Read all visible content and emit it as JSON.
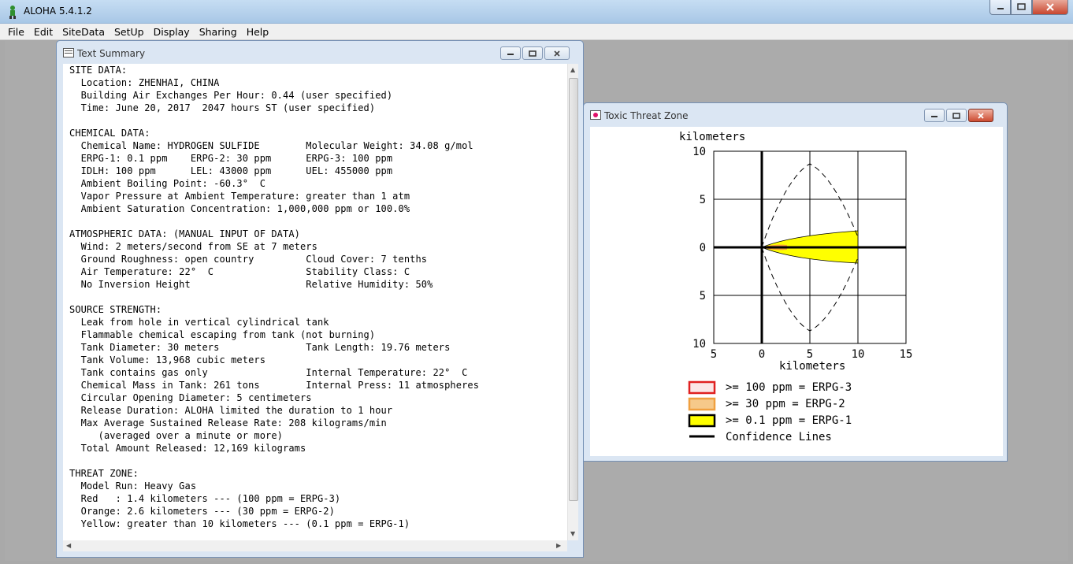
{
  "app": {
    "title": "ALOHA 5.4.1.2",
    "menu": [
      "File",
      "Edit",
      "SiteData",
      "SetUp",
      "Display",
      "Sharing",
      "Help"
    ]
  },
  "text_summary": {
    "title": "Text Summary",
    "lines": [
      "SITE DATA:",
      "  Location: ZHENHAI, CHINA",
      "  Building Air Exchanges Per Hour: 0.44 (user specified)",
      "  Time: June 20, 2017  2047 hours ST (user specified)",
      "",
      "CHEMICAL DATA:",
      "  Chemical Name: HYDROGEN SULFIDE        Molecular Weight: 34.08 g/mol",
      "  ERPG-1: 0.1 ppm    ERPG-2: 30 ppm      ERPG-3: 100 ppm",
      "  IDLH: 100 ppm      LEL: 43000 ppm      UEL: 455000 ppm",
      "  Ambient Boiling Point: -60.3°  C",
      "  Vapor Pressure at Ambient Temperature: greater than 1 atm",
      "  Ambient Saturation Concentration: 1,000,000 ppm or 100.0%",
      "",
      "ATMOSPHERIC DATA: (MANUAL INPUT OF DATA)",
      "  Wind: 2 meters/second from SE at 7 meters",
      "  Ground Roughness: open country         Cloud Cover: 7 tenths",
      "  Air Temperature: 22°  C                Stability Class: C",
      "  No Inversion Height                    Relative Humidity: 50%",
      "",
      "SOURCE STRENGTH:",
      "  Leak from hole in vertical cylindrical tank",
      "  Flammable chemical escaping from tank (not burning)",
      "  Tank Diameter: 30 meters               Tank Length: 19.76 meters",
      "  Tank Volume: 13,968 cubic meters",
      "  Tank contains gas only                 Internal Temperature: 22°  C",
      "  Chemical Mass in Tank: 261 tons        Internal Press: 11 atmospheres",
      "  Circular Opening Diameter: 5 centimeters",
      "  Release Duration: ALOHA limited the duration to 1 hour",
      "  Max Average Sustained Release Rate: 208 kilograms/min",
      "     (averaged over a minute or more)",
      "  Total Amount Released: 12,169 kilograms",
      "",
      "THREAT ZONE:",
      "  Model Run: Heavy Gas",
      "  Red   : 1.4 kilometers --- (100 ppm = ERPG-3)",
      "  Orange: 2.6 kilometers --- (30 ppm = ERPG-2)",
      "  Yellow: greater than 10 kilometers --- (0.1 ppm = ERPG-1)"
    ]
  },
  "toxic_zone": {
    "title": "Toxic Threat Zone",
    "axis_unit_top": "kilometers",
    "axis_unit_bottom": "kilometers",
    "y_ticks": [
      "10",
      "5",
      "0",
      "5",
      "10"
    ],
    "x_ticks": [
      "5",
      "0",
      "5",
      "10",
      "15"
    ],
    "legend": [
      {
        "label": ">= 100 ppm = ERPG-3",
        "color": "#e02020",
        "fill": "#fbe6e6"
      },
      {
        "label": ">= 30 ppm = ERPG-2",
        "color": "#f0a040",
        "fill": "#f6c98a"
      },
      {
        "label": ">= 0.1 ppm = ERPG-1",
        "color": "#000000",
        "fill": "#ffff00"
      },
      {
        "label": "Confidence Lines",
        "color": "#000000",
        "fill": ""
      }
    ]
  }
}
